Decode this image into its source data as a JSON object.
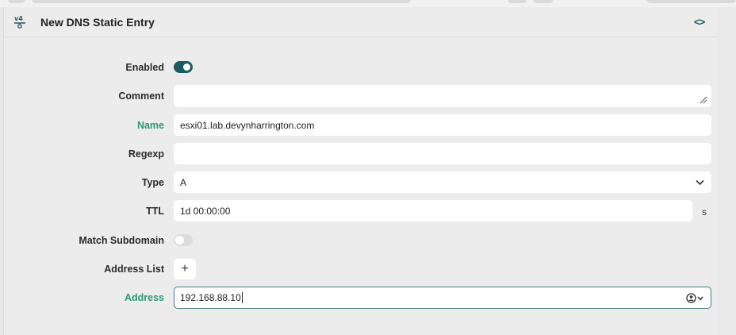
{
  "window": {
    "title": "New DNS Static Entry",
    "code_toggle": "<>"
  },
  "icons": {
    "header": "ipv4-route-icon",
    "resize": "resize-handle-icon",
    "dropdown": "chevron-down-icon",
    "account": "user-circle-icon"
  },
  "colors": {
    "accent": "#1e5b60",
    "highlight_label": "#2f9a78"
  },
  "form": {
    "enabled": {
      "label": "Enabled",
      "value": true
    },
    "comment": {
      "label": "Comment",
      "value": ""
    },
    "name": {
      "label": "Name",
      "value": "esxi01.lab.devynharrington.com"
    },
    "regexp": {
      "label": "Regexp",
      "value": ""
    },
    "type": {
      "label": "Type",
      "value": "A"
    },
    "ttl": {
      "label": "TTL",
      "value": "1d 00:00:00",
      "unit": "s"
    },
    "match_subdomain": {
      "label": "Match Subdomain",
      "value": false
    },
    "address_list": {
      "label": "Address List",
      "add_label": "+"
    },
    "address": {
      "label": "Address",
      "value": "192.168.88.10"
    }
  }
}
